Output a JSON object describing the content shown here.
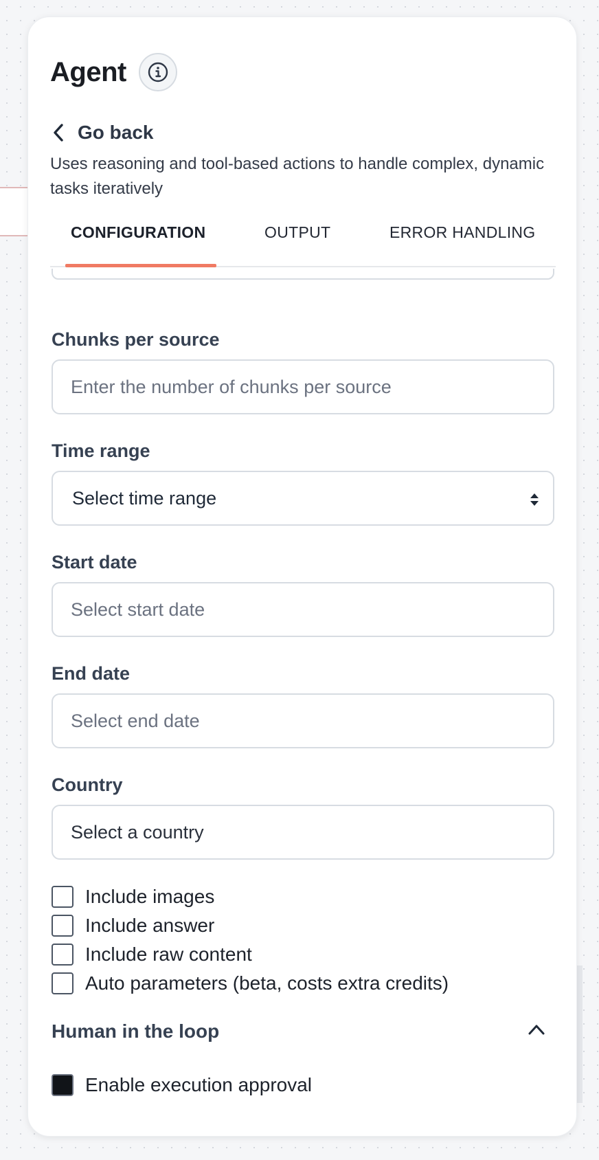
{
  "panel": {
    "title": "Agent",
    "back_label": "Go back",
    "description": "Uses reasoning and tool-based actions to handle complex, dynamic tasks iteratively"
  },
  "tabs": [
    {
      "label": "CONFIGURATION",
      "active": true
    },
    {
      "label": "OUTPUT",
      "active": false
    },
    {
      "label": "ERROR HANDLING",
      "active": false
    }
  ],
  "fields": {
    "chunks": {
      "label": "Chunks per source",
      "placeholder": "Enter the number of chunks per source"
    },
    "time_range": {
      "label": "Time range",
      "value": "Select time range"
    },
    "start_date": {
      "label": "Start date",
      "placeholder": "Select start date"
    },
    "end_date": {
      "label": "End date",
      "placeholder": "Select end date"
    },
    "country": {
      "label": "Country",
      "value": "Select a country"
    }
  },
  "checkboxes": [
    {
      "label": "Include images",
      "checked": false
    },
    {
      "label": "Include answer",
      "checked": false
    },
    {
      "label": "Include raw content",
      "checked": false
    },
    {
      "label": "Auto parameters (beta, costs extra credits)",
      "checked": false
    }
  ],
  "human_in_loop": {
    "title": "Human in the loop",
    "expanded": true,
    "approval": {
      "label": "Enable execution approval",
      "checked": true
    }
  },
  "colors": {
    "accent": "#f07a63",
    "checked_fill": "#111418"
  },
  "icons": {
    "info": "info-icon",
    "back": "chevron-left-icon",
    "select": "sort-icon",
    "collapse": "chevron-up-icon"
  }
}
